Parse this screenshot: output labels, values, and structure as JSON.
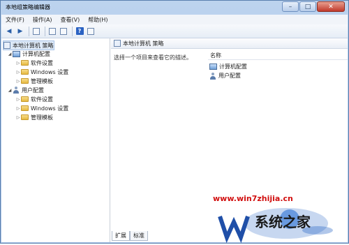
{
  "window": {
    "title": "本地组策略编辑器"
  },
  "menu": [
    "文件(F)",
    "操作(A)",
    "查看(V)",
    "帮助(H)"
  ],
  "tree": {
    "root": "本地计算机 策略",
    "computer_config": "计算机配置",
    "user_config": "用户配置",
    "software_settings": "软件设置",
    "windows_settings": "Windows 设置",
    "admin_templates": "管理模板"
  },
  "right": {
    "header": "本地计算机 策略",
    "description": "选择一个项目来查看它的描述。",
    "column_name": "名称",
    "items": [
      "计算机配置",
      "用户配置"
    ]
  },
  "tabs": [
    "扩展",
    "标准"
  ],
  "watermark": {
    "url": "www.win7zhijia.cn",
    "brand": "系统之家"
  },
  "colors": {
    "accent": "#2a62c3",
    "watermark_red": "#d10f0f"
  }
}
